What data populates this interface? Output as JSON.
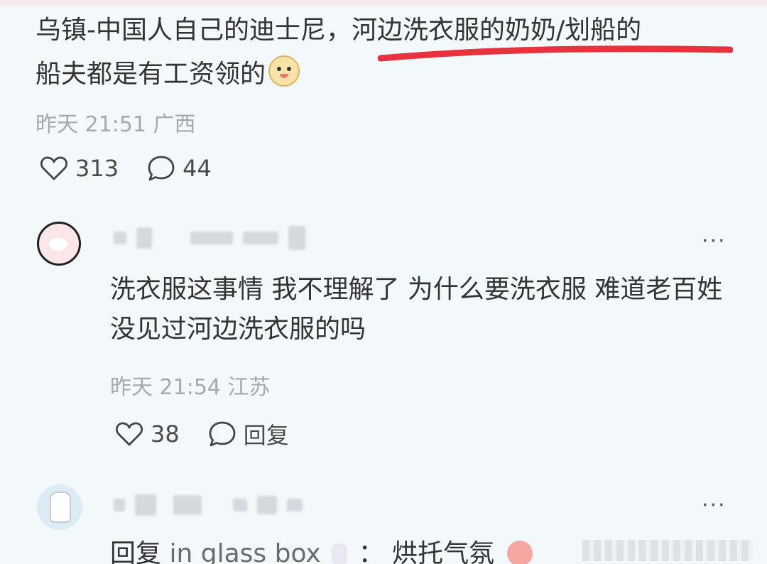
{
  "post": {
    "text_part1": "乌镇-中国人自己的迪士尼，",
    "text_part2": "河边洗衣服的奶奶/划船的",
    "text_part3": "船夫都是有工资领的",
    "emoji": "smile-face-emoji",
    "timestamp": "昨天 21:51",
    "location": "广西",
    "likes": "313",
    "comments": "44",
    "underline_color": "#e8323f"
  },
  "reply1": {
    "text": "洗衣服这事情 我不理解了 为什么要洗衣服 难道老百姓没见过河边洗衣服的吗",
    "timestamp": "昨天 21:54",
    "location": "江苏",
    "likes": "38",
    "reply_label": "回复",
    "more": "···"
  },
  "reply2": {
    "prefix": "回复",
    "mention": "in glass box",
    "colon": "：",
    "text": "烘托气氛",
    "more": "···"
  },
  "icons": {
    "like": "heart-icon",
    "comment": "comment-bubble-icon",
    "more": "more-dots-icon"
  }
}
